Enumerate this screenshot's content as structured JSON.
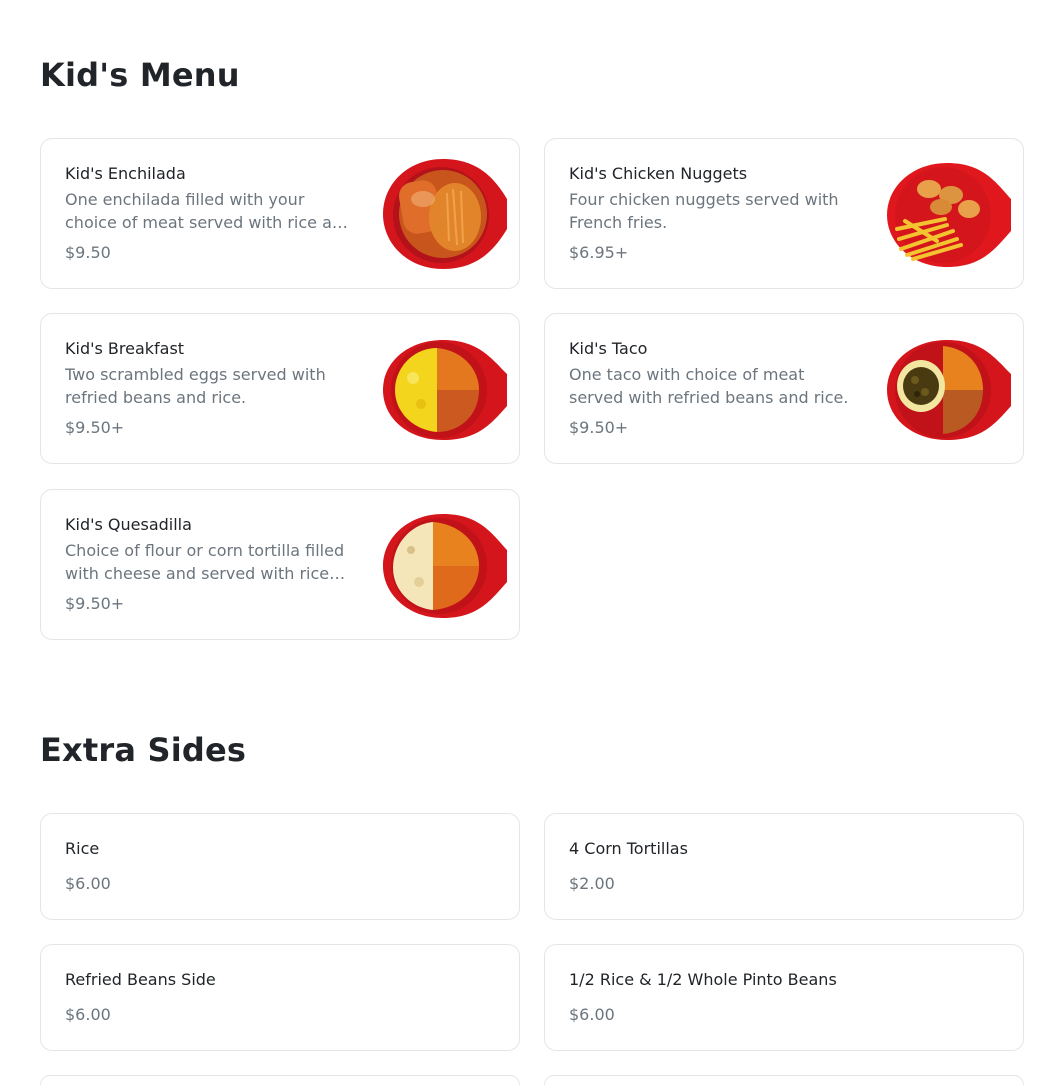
{
  "sections": [
    {
      "title": "Kid's Menu",
      "items": [
        {
          "name": "Kid's Enchilada",
          "description": "One enchilada filled with your choice of meat served with rice and beans.",
          "price": "$9.50",
          "image": "enchilada-plate"
        },
        {
          "name": "Kid's Chicken Nuggets",
          "description": "Four chicken nuggets served with French fries.",
          "price": "$6.95+",
          "image": "nuggets-plate"
        },
        {
          "name": "Kid's Breakfast",
          "description": "Two scrambled eggs served with refried beans and rice.",
          "price": "$9.50+",
          "image": "breakfast-plate"
        },
        {
          "name": "Kid's Taco",
          "description": "One taco with choice of meat served with refried beans and rice.",
          "price": "$9.50+",
          "image": "taco-plate"
        },
        {
          "name": "Kid's Quesadilla",
          "description": "Choice of flour or corn tortilla filled with cheese and served with rice and beans.",
          "price": "$9.50+",
          "image": "quesadilla-plate"
        }
      ]
    },
    {
      "title": "Extra Sides",
      "items": [
        {
          "name": "Rice",
          "price": "$6.00"
        },
        {
          "name": "4 Corn Tortillas",
          "price": "$2.00"
        },
        {
          "name": "Refried Beans Side",
          "price": "$6.00"
        },
        {
          "name": "1/2 Rice & 1/2 Whole Pinto Beans",
          "price": "$6.00"
        }
      ]
    }
  ],
  "colors": {
    "plate": "#d4161c",
    "rice": "#e8741f",
    "beans": "#c96a2a",
    "text": "#212529",
    "muted": "#6c757d"
  }
}
